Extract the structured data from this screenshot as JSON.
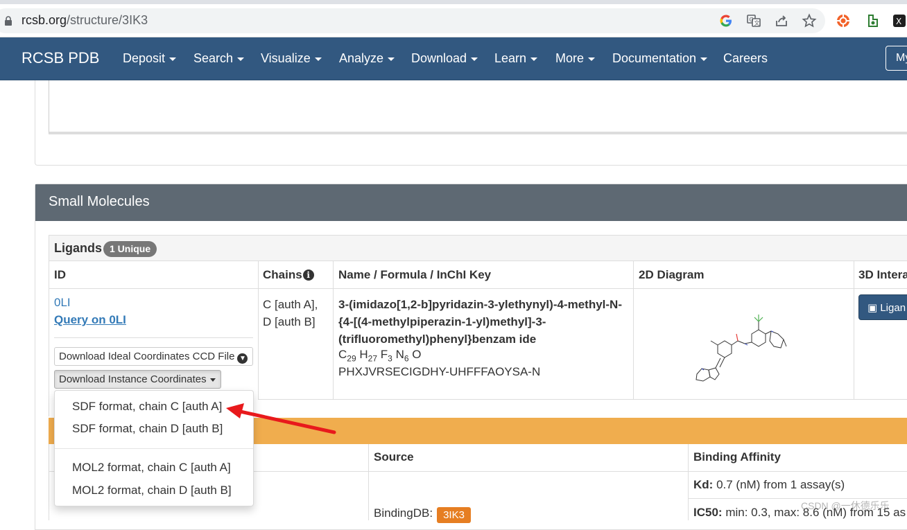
{
  "browser": {
    "url_host": "rcsb.org",
    "url_path": "/structure/3IK3",
    "icons": [
      "lock-icon",
      "google-icon",
      "translate-icon",
      "share-icon",
      "bookmark-star-icon",
      "extension-icon",
      "extension-icon-2",
      "extension-icon-3"
    ]
  },
  "navbar": {
    "brand": "RCSB PDB",
    "items": [
      {
        "label": "Deposit",
        "caret": true
      },
      {
        "label": "Search",
        "caret": true
      },
      {
        "label": "Visualize",
        "caret": true
      },
      {
        "label": "Analyze",
        "caret": true
      },
      {
        "label": "Download",
        "caret": true
      },
      {
        "label": "Learn",
        "caret": true
      },
      {
        "label": "More",
        "caret": true
      },
      {
        "label": "Documentation",
        "caret": true
      },
      {
        "label": "Careers",
        "caret": false
      }
    ],
    "my_button": "My"
  },
  "small_molecules": {
    "title": "Small Molecules",
    "ligands_label": "Ligands",
    "unique_badge": "1 Unique",
    "columns": [
      "ID",
      "Chains",
      "Name / Formula / InChI Key",
      "2D Diagram",
      "3D Intera"
    ],
    "row": {
      "id": "0LI",
      "query_link": "Query on 0LI",
      "download_ideal": "Download Ideal Coordinates CCD File",
      "download_instance": "Download Instance Coordinates",
      "chains_line1": "C [auth A],",
      "chains_line2": "D [auth B]",
      "name": "3-(imidazo[1,2-b]pyridazin-3-ylethynyl)-4-methyl-N-{4-[(4-methylpiperazin-1-yl)methyl]-3-(trifluoromethyl)phenyl}benzam ide",
      "formula": {
        "C": "C",
        "C_n": "29",
        "H": "H",
        "H_n": "27",
        "F": "F",
        "F_n": "3",
        "N": "N",
        "N_n": "6",
        "O": "O"
      },
      "inchi_key": "PHXJVRSECIGDHY-UHFFFAOYSA-N",
      "ligand_button": "Ligan"
    },
    "dropdown": [
      "SDF format, chain C [auth A]",
      "SDF format, chain D [auth B]",
      "MOL2 format, chain C [auth A]",
      "MOL2 format, chain D [auth B]"
    ],
    "binding": {
      "source_header": "Source",
      "affinity_header": "Binding Affinity",
      "kd_label": "Kd:",
      "kd_text": "0.7 (nM) from 1 assay(s)",
      "ic50_label": "IC50:",
      "ic50_text": "min: 0.3, max: 8.6 (nM) from 15 as",
      "source_name": "BindingDB:",
      "source_badge": "3IK3"
    }
  },
  "watermark": "CSDN @一休德乐乐",
  "colors": {
    "navbar": "#325880",
    "panel_header": "#5e6973",
    "orange_bar": "#f0ad4e",
    "badge_3ik3": "#e67e22",
    "link": "#337ab7",
    "arrow": "#e8191c"
  }
}
